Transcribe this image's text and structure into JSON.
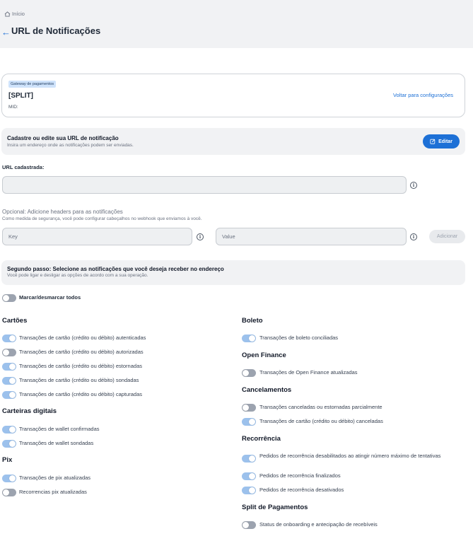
{
  "breadcrumb": {
    "home": "Início"
  },
  "header": {
    "back_icon": "arrow-left-icon",
    "title": "URL de Notificações"
  },
  "gateway": {
    "badge": "Gateway de pagamentos",
    "name": "[SPLIT]",
    "mid": "MID:",
    "back_link": "Voltar para configurações"
  },
  "register": {
    "title": "Cadastre ou edite sua URL de notificação",
    "subtitle": "Insira um endereço onde as notificações podem ser enviadas.",
    "edit_button": "Editar"
  },
  "url_field": {
    "label": "URL cadastrada:",
    "value": ""
  },
  "headers": {
    "title": "Opcional: Adicione headers para as notificações",
    "subtitle": "Como medida de segurança, você pode configurar cabeçalhos no webhook que enviamos à você.",
    "key_placeholder": "Key",
    "value_placeholder": "Value",
    "add_button": "Adicionar"
  },
  "step2": {
    "title": "Segundo passo: Selecione as notificações que você deseja receber no endereço",
    "subtitle": "Você pode ligar e desligar as opções de acordo com a sua operação."
  },
  "master_toggle": {
    "label": "Marcar/desmarcar todos",
    "on": false
  },
  "left_sections": [
    {
      "title": "Cartões",
      "items": [
        {
          "label": "Transações de cartão (crédito ou débito) autenticadas",
          "on": true
        },
        {
          "label": "Transações de cartão (crédito ou débito) autorizadas",
          "on": false
        },
        {
          "label": "Transações de cartão (crédito ou débito) estornadas",
          "on": true
        },
        {
          "label": "Transações de cartão (crédito ou débito) sondadas",
          "on": true
        },
        {
          "label": "Transações de cartão (crédito ou débito) capturadas",
          "on": true
        }
      ]
    },
    {
      "title": "Carteiras digitais",
      "items": [
        {
          "label": "Transações de wallet confirmadas",
          "on": true
        },
        {
          "label": "Transações de wallet sondadas",
          "on": true
        }
      ]
    },
    {
      "title": "Pix",
      "items": [
        {
          "label": "Transações de pix atualizadas",
          "on": true
        },
        {
          "label": "Recorrencias pix atualizadas",
          "on": false
        }
      ]
    }
  ],
  "right_sections": [
    {
      "title": "Boleto",
      "items": [
        {
          "label": "Transações de boleto conciliadas",
          "on": true
        }
      ]
    },
    {
      "title": "Open Finance",
      "items": [
        {
          "label": "Transações de Open Finance atualizadas",
          "on": false
        }
      ]
    },
    {
      "title": "Cancelamentos",
      "items": [
        {
          "label": "Transações canceladas ou estornadas parcialmente",
          "on": false
        },
        {
          "label": "Transações de cartão (crédito ou débito) canceladas",
          "on": true
        }
      ]
    },
    {
      "title": "Recorrência",
      "items": [
        {
          "label": "Pedidos de recorrência desabilitados ao atingir número máximo de tentativas",
          "on": true
        },
        {
          "label": "Pedidos de recorrência finalizados",
          "on": true
        },
        {
          "label": "Pedidos de recorrência desativados",
          "on": true
        }
      ]
    },
    {
      "title": "Split de Pagamentos",
      "items": [
        {
          "label": "Status de onboarding e antecipação de recebíveis",
          "on": false
        }
      ]
    }
  ],
  "colors": {
    "accent": "#1d70d6",
    "toggle_on": "#9cc1ec",
    "toggle_off": "#9ca3af",
    "header_bg": "#f1f2f4"
  }
}
